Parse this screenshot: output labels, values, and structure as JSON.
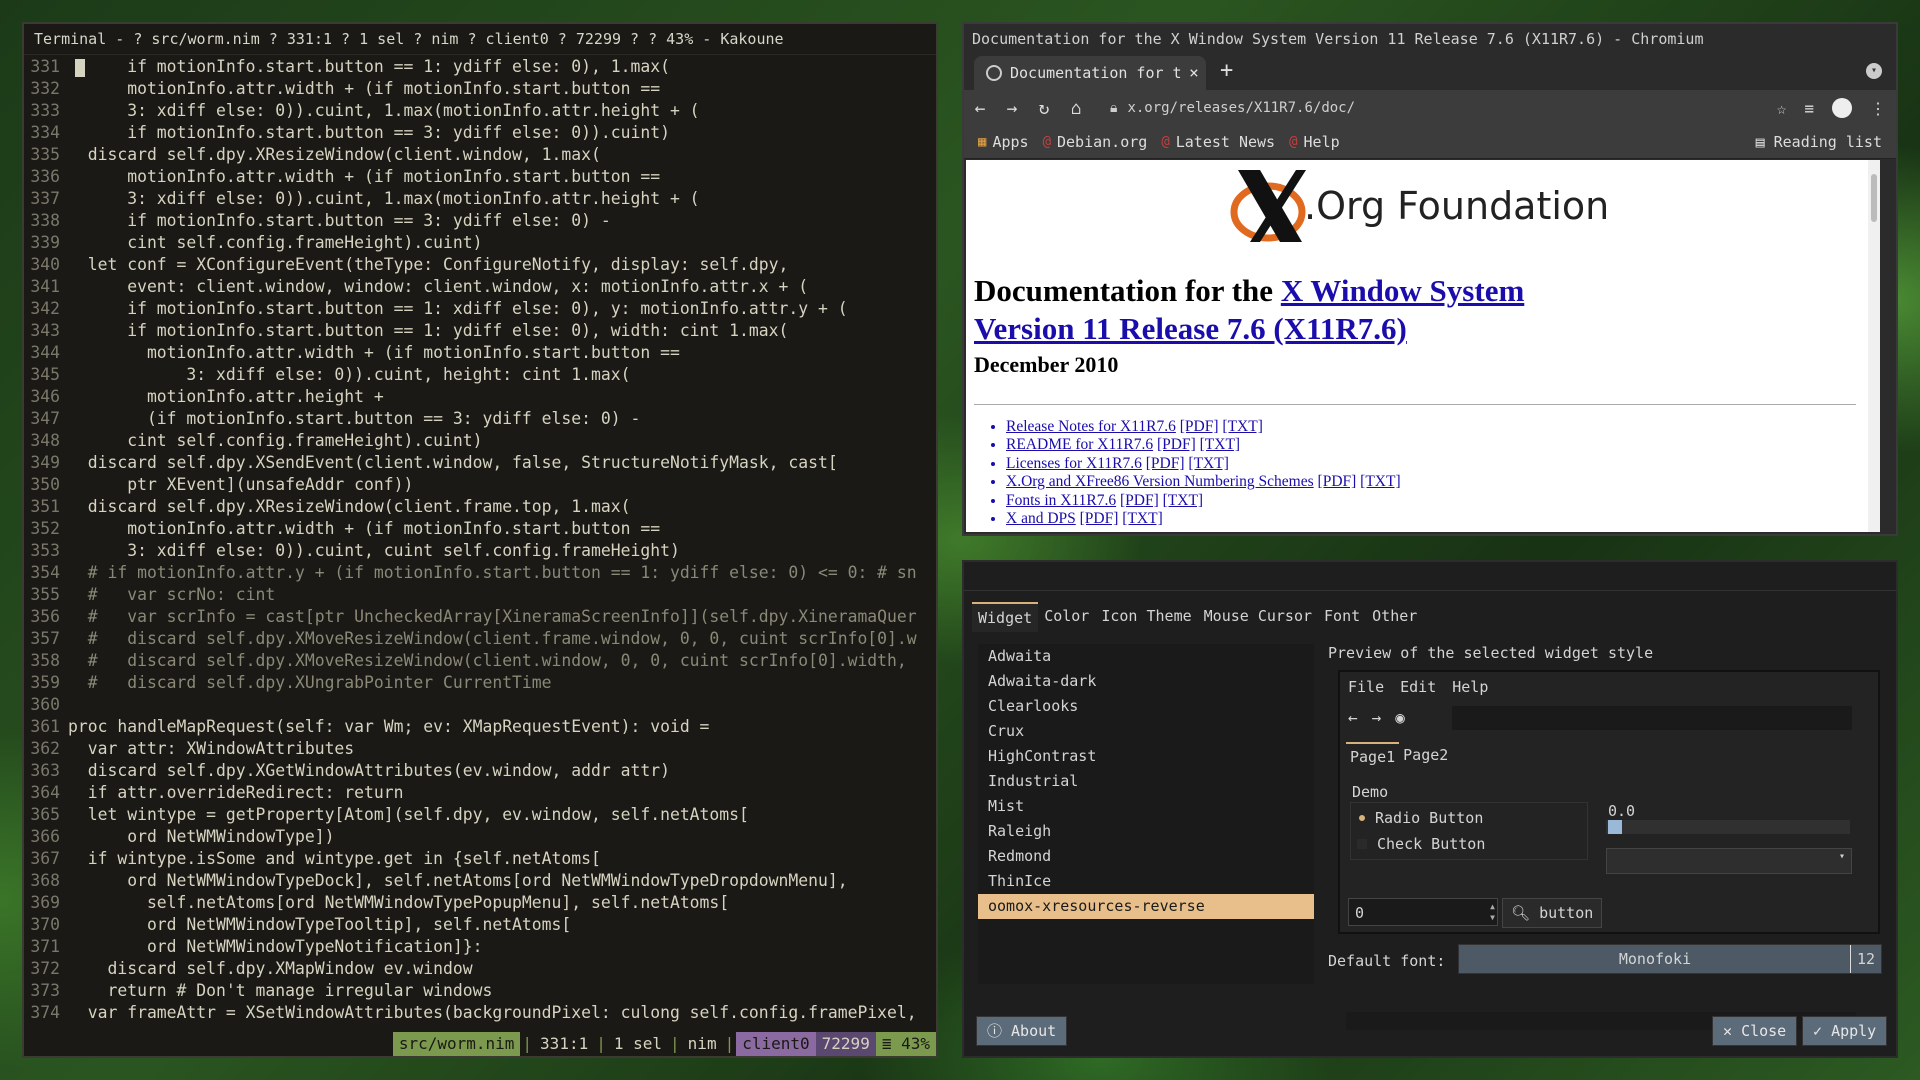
{
  "terminal": {
    "title": "Terminal - ? src/worm.nim ? 331:1 ? 1 sel ? nim ? client0 ? 72299 ? ? 43% - Kakoune",
    "lines": [
      {
        "n": "331",
        "t": "      if motionInfo.start.button == 1: ydiff else: 0), 1.max("
      },
      {
        "n": "332",
        "t": "      motionInfo.attr.width + (if motionInfo.start.button =="
      },
      {
        "n": "333",
        "t": "      3: xdiff else: 0)).cuint, 1.max(motionInfo.attr.height + ("
      },
      {
        "n": "334",
        "t": "      if motionInfo.start.button == 3: ydiff else: 0)).cuint)"
      },
      {
        "n": "335",
        "t": "  discard self.dpy.XResizeWindow(client.window, 1.max("
      },
      {
        "n": "336",
        "t": "      motionInfo.attr.width + (if motionInfo.start.button =="
      },
      {
        "n": "337",
        "t": "      3: xdiff else: 0)).cuint, 1.max(motionInfo.attr.height + ("
      },
      {
        "n": "338",
        "t": "      if motionInfo.start.button == 3: ydiff else: 0) -"
      },
      {
        "n": "339",
        "t": "      cint self.config.frameHeight).cuint)"
      },
      {
        "n": "340",
        "t": "  let conf = XConfigureEvent(theType: ConfigureNotify, display: self.dpy,"
      },
      {
        "n": "341",
        "t": "      event: client.window, window: client.window, x: motionInfo.attr.x + ("
      },
      {
        "n": "342",
        "t": "      if motionInfo.start.button == 1: xdiff else: 0), y: motionInfo.attr.y + ("
      },
      {
        "n": "343",
        "t": "      if motionInfo.start.button == 1: ydiff else: 0), width: cint 1.max("
      },
      {
        "n": "344",
        "t": "        motionInfo.attr.width + (if motionInfo.start.button =="
      },
      {
        "n": "345",
        "t": "            3: xdiff else: 0)).cuint, height: cint 1.max("
      },
      {
        "n": "346",
        "t": "        motionInfo.attr.height +"
      },
      {
        "n": "347",
        "t": "        (if motionInfo.start.button == 3: ydiff else: 0) -"
      },
      {
        "n": "348",
        "t": "      cint self.config.frameHeight).cuint)"
      },
      {
        "n": "349",
        "t": "  discard self.dpy.XSendEvent(client.window, false, StructureNotifyMask, cast["
      },
      {
        "n": "350",
        "t": "      ptr XEvent](unsafeAddr conf))"
      },
      {
        "n": "351",
        "t": "  discard self.dpy.XResizeWindow(client.frame.top, 1.max("
      },
      {
        "n": "352",
        "t": "      motionInfo.attr.width + (if motionInfo.start.button =="
      },
      {
        "n": "353",
        "t": "      3: xdiff else: 0)).cuint, cuint self.config.frameHeight)"
      },
      {
        "n": "354",
        "t": "  # if motionInfo.attr.y + (if motionInfo.start.button == 1: ydiff else: 0) <= 0: # sn",
        "c": true
      },
      {
        "n": "355",
        "t": "  #   var scrNo: cint",
        "c": true
      },
      {
        "n": "356",
        "t": "  #   var scrInfo = cast[ptr UncheckedArray[XineramaScreenInfo]](self.dpy.XineramaQuer",
        "c": true
      },
      {
        "n": "357",
        "t": "  #   discard self.dpy.XMoveResizeWindow(client.frame.window, 0, 0, cuint scrInfo[0].w",
        "c": true
      },
      {
        "n": "358",
        "t": "  #   discard self.dpy.XMoveResizeWindow(client.window, 0, 0, cuint scrInfo[0].width,",
        "c": true
      },
      {
        "n": "359",
        "t": "  #   discard self.dpy.XUngrabPointer CurrentTime",
        "c": true
      },
      {
        "n": "360",
        "t": ""
      },
      {
        "n": "361",
        "t": "proc handleMapRequest(self: var Wm; ev: XMapRequestEvent): void ="
      },
      {
        "n": "362",
        "t": "  var attr: XWindowAttributes"
      },
      {
        "n": "363",
        "t": "  discard self.dpy.XGetWindowAttributes(ev.window, addr attr)"
      },
      {
        "n": "364",
        "t": "  if attr.overrideRedirect: return"
      },
      {
        "n": "365",
        "t": "  let wintype = getProperty[Atom](self.dpy, ev.window, self.netAtoms["
      },
      {
        "n": "366",
        "t": "      ord NetWMWindowType])"
      },
      {
        "n": "367",
        "t": "  if wintype.isSome and wintype.get in {self.netAtoms["
      },
      {
        "n": "368",
        "t": "      ord NetWMWindowTypeDock], self.netAtoms[ord NetWMWindowTypeDropdownMenu],"
      },
      {
        "n": "369",
        "t": "        self.netAtoms[ord NetWMWindowTypePopupMenu], self.netAtoms["
      },
      {
        "n": "370",
        "t": "        ord NetWMWindowTypeTooltip], self.netAtoms["
      },
      {
        "n": "371",
        "t": "        ord NetWMWindowTypeNotification]}:"
      },
      {
        "n": "372",
        "t": "    discard self.dpy.XMapWindow ev.window"
      },
      {
        "n": "373",
        "t": "    return # Don't manage irregular windows"
      },
      {
        "n": "374",
        "t": "  var frameAttr = XSetWindowAttributes(backgroundPixel: culong self.config.framePixel,"
      }
    ],
    "status": {
      "file": "src/worm.nim",
      "pos": "331:1",
      "sel": "1 sel",
      "lang": "nim",
      "client": "client0",
      "pid": "72299",
      "pct": "≣ 43%"
    }
  },
  "browser": {
    "title": "Documentation for the X Window System Version 11 Release 7.6 (X11R7.6) - Chromium",
    "tab_title": "Documentation for t",
    "tab_close": "×",
    "newtab": "+",
    "url": "x.org/releases/X11R7.6/doc/",
    "bookmarks": [
      "Apps",
      "Debian.org",
      "Latest News",
      "Help"
    ],
    "reading_list": "Reading list",
    "logo_text": ".Org Foundation",
    "heading_prefix": "Documentation for the ",
    "heading_link": "X Window System Version 11 Release 7.6 (X11R7.6)",
    "date": "December 2010",
    "links": [
      {
        "text": "Release Notes for X11R7.6",
        "pdf": "[PDF]",
        "txt": "[TXT]"
      },
      {
        "text": "README for X11R7.6",
        "pdf": "[PDF]",
        "txt": "[TXT]"
      },
      {
        "text": "Licenses for X11R7.6",
        "pdf": "[PDF]",
        "txt": "[TXT]"
      },
      {
        "text": "X.Org and XFree86 Version Numbering Schemes",
        "pdf": "[PDF]",
        "txt": "[TXT]"
      },
      {
        "text": "Fonts in X11R7.6",
        "pdf": "[PDF]",
        "txt": "[TXT]"
      },
      {
        "text": "X and DPS",
        "pdf": "[PDF]",
        "txt": "[TXT]"
      }
    ]
  },
  "gtk": {
    "tabs": [
      "Widget",
      "Color",
      "Icon Theme",
      "Mouse Cursor",
      "Font",
      "Other"
    ],
    "themes": [
      "Adwaita",
      "Adwaita-dark",
      "Clearlooks",
      "Crux",
      "HighContrast",
      "Industrial",
      "Mist",
      "Raleigh",
      "Redmond",
      "ThinIce",
      "oomox-xresources-reverse"
    ],
    "selected_theme": "oomox-xresources-reverse",
    "preview_label": "Preview of the selected widget style",
    "preview": {
      "menu": [
        "File",
        "Edit",
        "Help"
      ],
      "tabs": [
        "Page1",
        "Page2"
      ],
      "demo": "Demo",
      "radio": "Radio Button",
      "check": "Check Button",
      "spin_value": "0",
      "button": "button",
      "scale_value": "0.0",
      "scale_fraction": 0.0
    },
    "default_font_label": "Default font:",
    "font_name": "Monofoki",
    "font_size": "12",
    "about": "About",
    "close": "Close",
    "apply": "Apply"
  }
}
